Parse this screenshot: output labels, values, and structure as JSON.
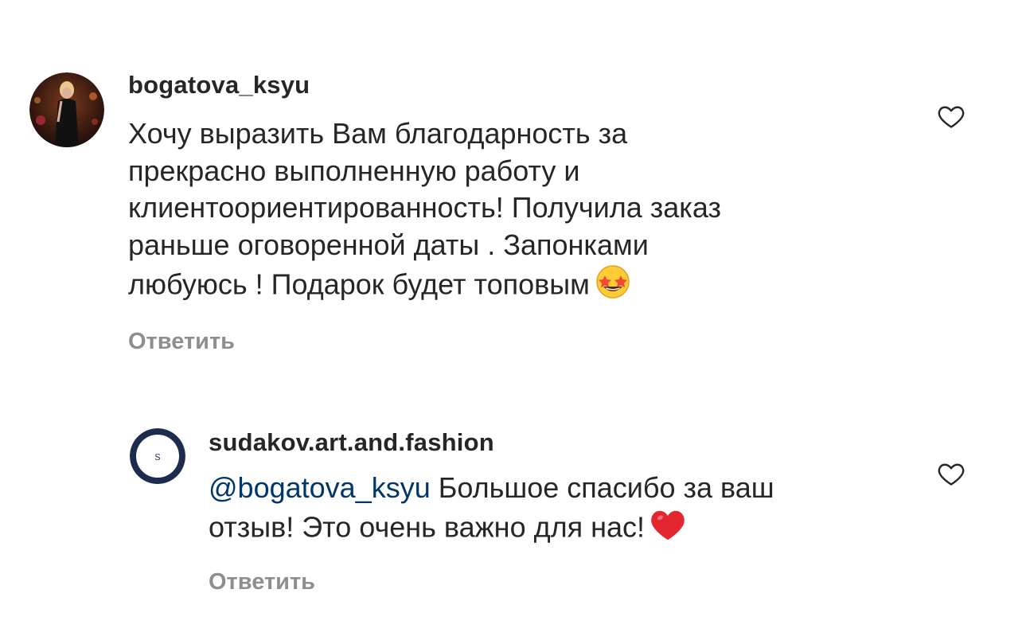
{
  "comments": [
    {
      "username": "bogatova_ksyu",
      "avatar_icon": "user-photo-avatar",
      "text": "Хочу выразить Вам благодарность за\nпрекрасно выполненную работу  и\nклиентоориентированность! Получила заказ\nраньше оговоренной  даты . Запонками\nлюбуюсь ! Подарок будет топовым",
      "emoji": "star-struck-emoji",
      "reply_label": "Ответить",
      "like_icon": "heart-outline-icon"
    },
    {
      "username": "sudakov.art.and.fashion",
      "avatar_icon": "brand-logo-avatar",
      "avatar_letter": "S",
      "mention": "@bogatova_ksyu",
      "text": " Большое спасибо за ваш\nотзыв! Это очень важно для нас!",
      "emoji": "red-heart-emoji",
      "reply_label": "Ответить",
      "like_icon": "heart-outline-icon"
    }
  ],
  "colors": {
    "text": "#262626",
    "secondary": "#8e8e8e",
    "mention": "#00376b",
    "brand_ring": "#1d2b4f"
  }
}
